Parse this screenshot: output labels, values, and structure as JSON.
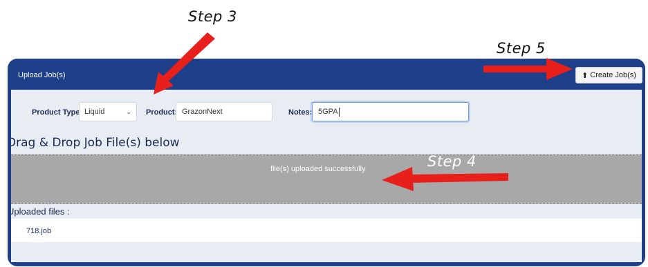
{
  "annotations": {
    "step3": "Step 3",
    "step4": "Step 4",
    "step5": "Step 5",
    "arrow_color": "#e8201c"
  },
  "panel": {
    "title": "Upload Job(s)",
    "create_button": {
      "icon": "upload-icon",
      "label": "Create Job(s)"
    }
  },
  "form": {
    "product_type": {
      "label": "Product Type:",
      "value": "Liquid"
    },
    "product": {
      "label": "Product:",
      "value": "GrazonNext"
    },
    "notes": {
      "label": "Notes:",
      "value": "5GPA"
    }
  },
  "dropzone": {
    "title": "Drag & Drop Job File(s) below",
    "message": "file(s) uploaded successfully"
  },
  "uploaded": {
    "label": "Uploaded files :",
    "files": [
      "718.job"
    ]
  },
  "colors": {
    "header_blue": "#1e3f8a",
    "body_bg": "#e8ecf3",
    "dropzone_bg": "#a8a8a8"
  }
}
